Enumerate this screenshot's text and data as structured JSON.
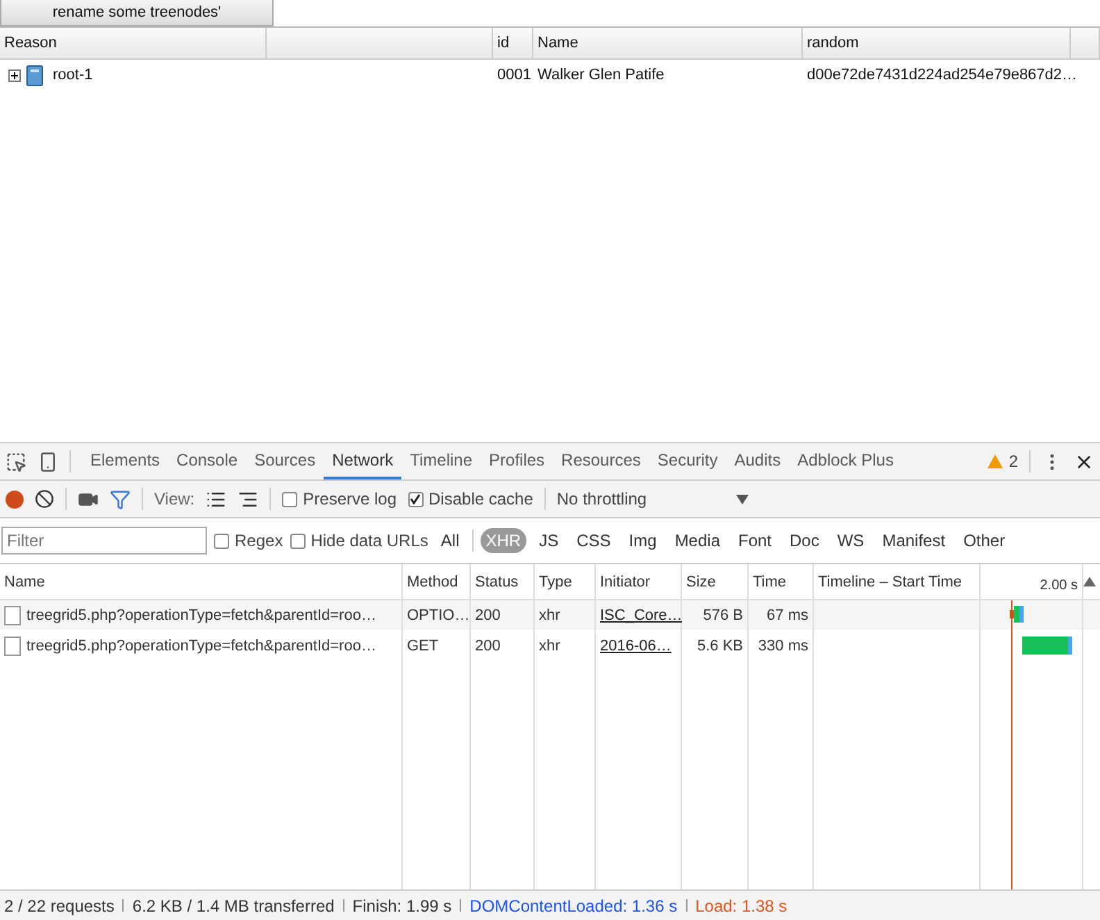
{
  "app": {
    "button": "rename some treenodes'",
    "grid": {
      "columns": [
        "Reason",
        "id",
        "Name",
        "random"
      ],
      "rows": [
        {
          "reason": "root-1",
          "id": "0001",
          "name": "Walker Glen Patife",
          "random": "d00e72de7431d224ad254e79e867d2…",
          "expanded": false
        }
      ]
    }
  },
  "devtools": {
    "tabs": [
      {
        "label": "Elements",
        "selected": false
      },
      {
        "label": "Console",
        "selected": false
      },
      {
        "label": "Sources",
        "selected": false
      },
      {
        "label": "Network",
        "selected": true
      },
      {
        "label": "Timeline",
        "selected": false
      },
      {
        "label": "Profiles",
        "selected": false
      },
      {
        "label": "Resources",
        "selected": false
      },
      {
        "label": "Security",
        "selected": false
      },
      {
        "label": "Audits",
        "selected": false
      },
      {
        "label": "Adblock Plus",
        "selected": false
      }
    ],
    "warnings": "2",
    "toolbar": {
      "recording": true,
      "view_label": "View:",
      "preserve_log": {
        "label": "Preserve log",
        "checked": false
      },
      "disable_cache": {
        "label": "Disable cache",
        "checked": true
      },
      "throttling": "No throttling"
    },
    "filter": {
      "placeholder": "Filter",
      "regex": {
        "label": "Regex",
        "checked": false
      },
      "hide_data_urls": {
        "label": "Hide data URLs",
        "checked": false
      },
      "types": [
        {
          "label": "All",
          "selected": false
        },
        {
          "label": "XHR",
          "selected": true
        },
        {
          "label": "JS",
          "selected": false
        },
        {
          "label": "CSS",
          "selected": false
        },
        {
          "label": "Img",
          "selected": false
        },
        {
          "label": "Media",
          "selected": false
        },
        {
          "label": "Font",
          "selected": false
        },
        {
          "label": "Doc",
          "selected": false
        },
        {
          "label": "WS",
          "selected": false
        },
        {
          "label": "Manifest",
          "selected": false
        },
        {
          "label": "Other",
          "selected": false
        }
      ]
    },
    "table": {
      "columns": [
        "Name",
        "Method",
        "Status",
        "Type",
        "Initiator",
        "Size",
        "Time",
        "Timeline – Start Time"
      ],
      "timeline_tick": "2.00 s",
      "rows": [
        {
          "name": "treegrid5.php?operationType=fetch&parentId=roo…",
          "method": "OPTIO…",
          "status": "200",
          "type": "xhr",
          "initiator": "ISC_Core…",
          "size": "576 B",
          "time": "67 ms",
          "kind": "short"
        },
        {
          "name": "treegrid5.php?operationType=fetch&parentId=roo…",
          "method": "GET",
          "status": "200",
          "type": "xhr",
          "initiator": "2016-06…",
          "size": "5.6 KB",
          "time": "330 ms",
          "kind": "long"
        }
      ]
    },
    "status_bar": [
      {
        "text": "2 / 22 requests",
        "color": "#333333"
      },
      {
        "text": "6.2 KB / 1.4 MB transferred",
        "color": "#333333"
      },
      {
        "text": "Finish: 1.99 s",
        "color": "#333333"
      },
      {
        "text": "DOMContentLoaded: 1.36 s",
        "color": "#1a53f0"
      },
      {
        "text": "Load: 1.38 s",
        "color": "#e0541c"
      }
    ]
  }
}
